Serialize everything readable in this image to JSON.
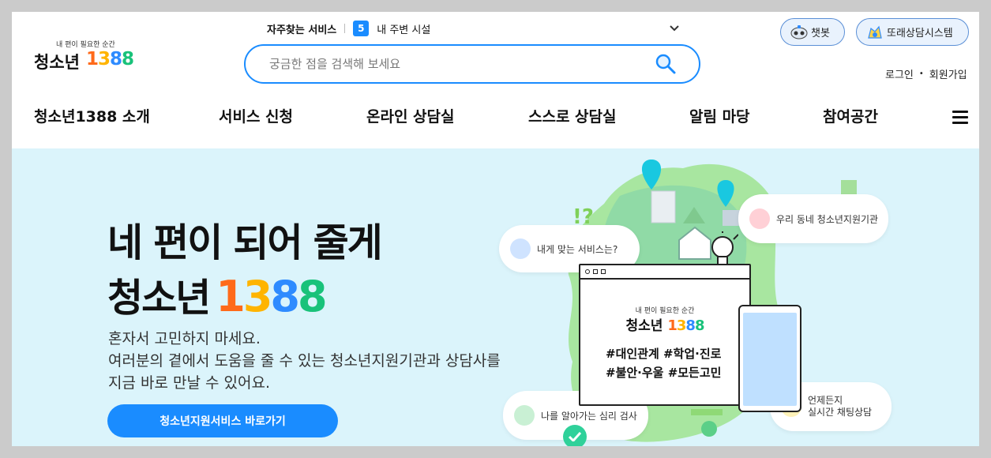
{
  "header": {
    "logo": {
      "tagline": "내 편이 필요한 순간",
      "name": "청소년",
      "num": [
        "1",
        "3",
        "8",
        "8"
      ]
    },
    "favorites_label": "자주찾는 서비스",
    "rank_number": "5",
    "rank_text": "내 주변 시설",
    "search_placeholder": "궁금한 점을 검색해 보세요",
    "chatbot_label": "챗봇",
    "system_label": "또래상담시스템",
    "login_label": "로그인",
    "signup_label": "회원가입"
  },
  "nav": {
    "items": [
      "청소년1388 소개",
      "서비스 신청",
      "온라인 상담실",
      "스스로 상담실",
      "알림 마당",
      "참여공간"
    ]
  },
  "hero": {
    "headline1": "네 편이 되어 줄게",
    "headline2": "청소년",
    "desc_lines": [
      "혼자서 고민하지 마세요.",
      "여러분의 곁에서 도움을 줄 수 있는 청소년지원기관과 상담사를",
      "지금 바로 만날 수 있어요."
    ],
    "cta_label": "청소년지원서비스 바로가기",
    "bubbles": {
      "service": "내게 맞는 서비스는?",
      "local": "우리 동네 청소년지원기관",
      "test": "나를 알아가는 심리 검사",
      "chat_line1": "언제든지",
      "chat_line2": "실시간 채팅상담"
    },
    "card": {
      "tagline": "내 편이 필요한 순간",
      "name": "청소년",
      "hash_line1": "#대인관계 #학업·진로",
      "hash_line2": "#불안·우울 #모든고민"
    }
  },
  "colors": {
    "primary": "#1a8cff",
    "hero_bg": "#dbf4fb",
    "one": "#ff6a1a",
    "three": "#ffb400",
    "eight_a": "#2e8bff",
    "eight_b": "#19c27a"
  },
  "icons": [
    "search-icon",
    "chevron-down-icon",
    "chatbot-icon",
    "peer-system-icon",
    "hamburger-menu-icon",
    "lightbulb-icon",
    "check-icon"
  ]
}
